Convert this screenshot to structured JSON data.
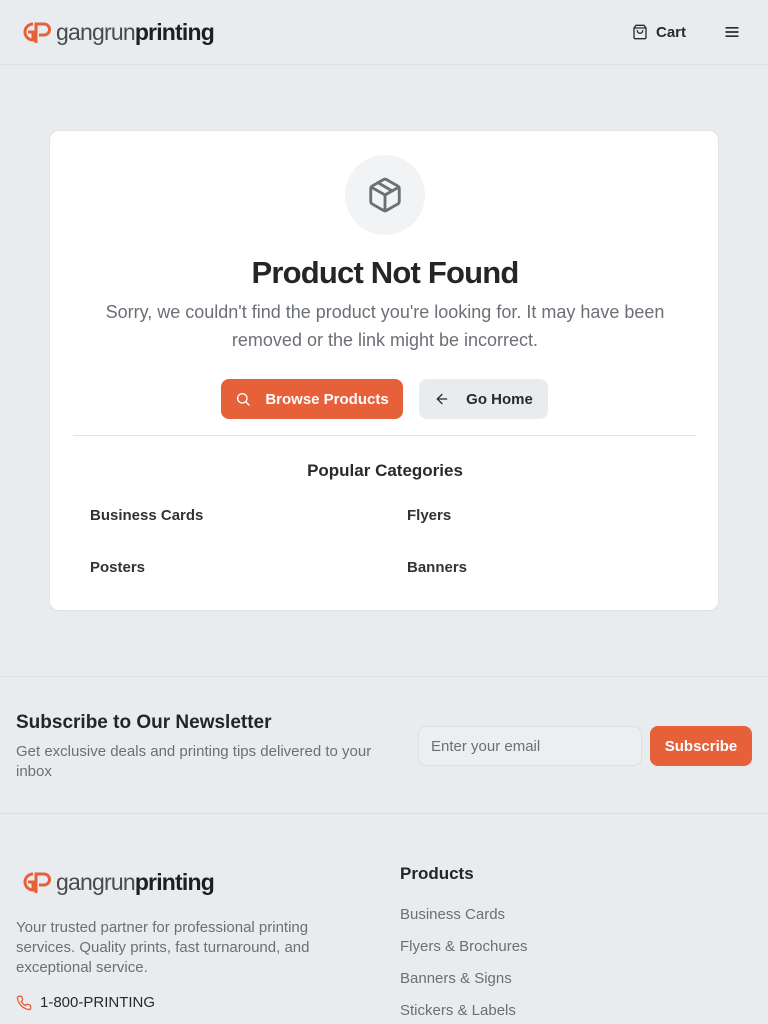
{
  "brand": {
    "logo_light": "gangrun",
    "logo_bold": "printing",
    "accent": "#e6603a"
  },
  "header": {
    "cart_label": "Cart",
    "cart_icon": "shopping-bag-icon",
    "menu_icon": "hamburger-menu-icon"
  },
  "card": {
    "icon": "package-box-icon",
    "title": "Product Not Found",
    "description": "Sorry, we couldn't find the product you're looking for. It may have been removed or the link might be incorrect.",
    "primary_button": "Browse Products",
    "secondary_button": "Go Home",
    "categories_title": "Popular Categories",
    "categories": [
      "Business Cards",
      "Flyers",
      "Posters",
      "Banners"
    ]
  },
  "newsletter": {
    "title": "Subscribe to Our Newsletter",
    "subtitle": "Get exclusive deals and printing tips delivered to your inbox",
    "placeholder": "Enter your email",
    "button": "Subscribe"
  },
  "footer": {
    "description": "Your trusted partner for professional printing services. Quality prints, fast turnaround, and exceptional service.",
    "phone": "1-800-PRINTING",
    "products_title": "Products",
    "products": [
      "Business Cards",
      "Flyers & Brochures",
      "Banners & Signs",
      "Stickers & Labels"
    ]
  }
}
